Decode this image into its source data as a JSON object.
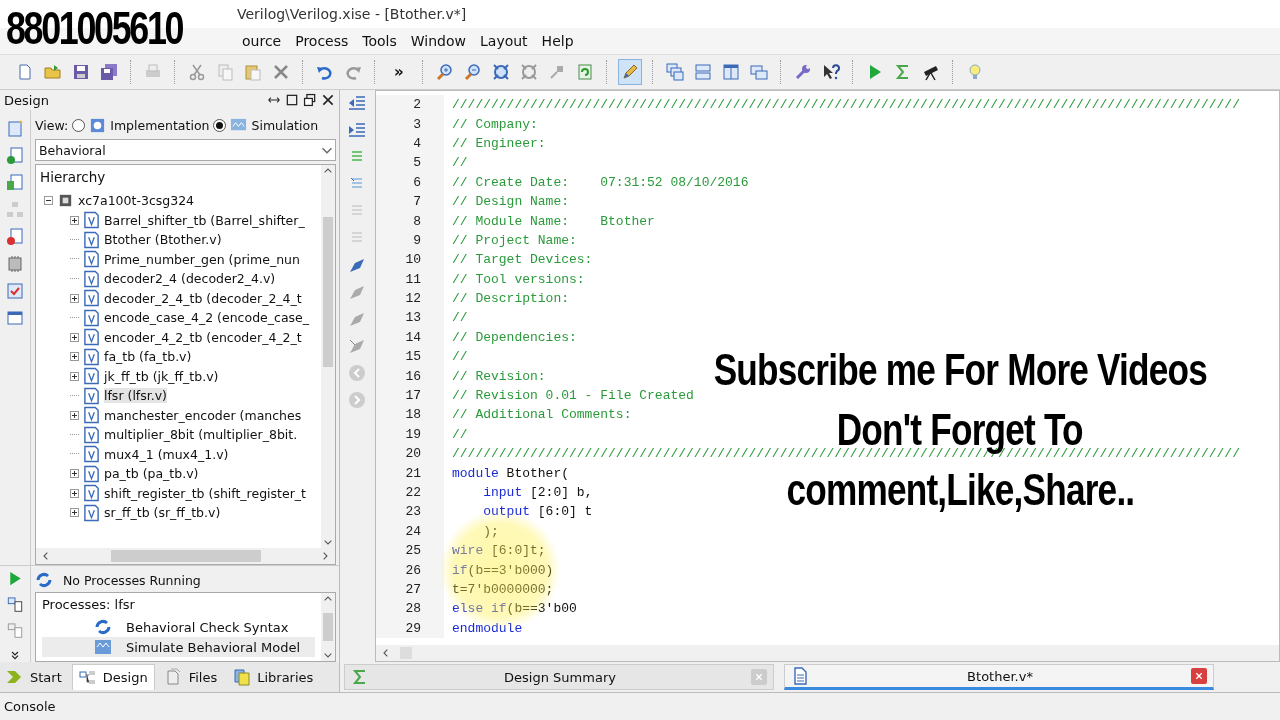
{
  "overlay_caption": {
    "phone": "8801005610",
    "lines": [
      "Subscribe me For More Videos",
      "Don't Forget To",
      "comment,Like,Share.."
    ]
  },
  "window": {
    "title": "Verilog\\Verilog.xise - [Btother.v*]"
  },
  "menu": [
    "ource",
    "Process",
    "Tools",
    "Window",
    "Layout",
    "Help"
  ],
  "toolbar": {
    "overflow": "»"
  },
  "design_panel": {
    "title": "Design",
    "view_label": "View:",
    "views": [
      {
        "label": "Implementation",
        "selected": false
      },
      {
        "label": "Simulation",
        "selected": true
      }
    ],
    "dropdown": {
      "value": "Behavioral"
    },
    "hierarchy": {
      "title": "Hierarchy",
      "tree": [
        {
          "label": "xc7a100t-3csg324",
          "expanded": true,
          "children": [
            {
              "label": "Barrel_shifter_tb (Barrel_shifter_",
              "kind": "group",
              "selected": false
            },
            {
              "label": "Btother (Btother.v)",
              "kind": "file",
              "selected": false
            },
            {
              "label": "Prime_number_gen (prime_nun",
              "kind": "file",
              "selected": false
            },
            {
              "label": "decoder2_4 (decoder2_4.v)",
              "kind": "file",
              "selected": false
            },
            {
              "label": "decoder_2_4_tb (decoder_2_4_t",
              "kind": "group",
              "selected": false
            },
            {
              "label": "encode_case_4_2 (encode_case_",
              "kind": "file",
              "selected": false
            },
            {
              "label": "encoder_4_2_tb (encoder_4_2_t",
              "kind": "group",
              "selected": false
            },
            {
              "label": "fa_tb (fa_tb.v)",
              "kind": "group",
              "selected": false
            },
            {
              "label": "jk_ff_tb (jk_ff_tb.v)",
              "kind": "group",
              "selected": false
            },
            {
              "label": "lfsr (lfsr.v)",
              "kind": "file",
              "selected": true
            },
            {
              "label": "manchester_encoder (manches",
              "kind": "group",
              "selected": false
            },
            {
              "label": "multiplier_8bit (multiplier_8bit.",
              "kind": "file",
              "selected": false
            },
            {
              "label": "mux4_1 (mux4_1.v)",
              "kind": "file",
              "selected": false
            },
            {
              "label": "pa_tb (pa_tb.v)",
              "kind": "group",
              "selected": false
            },
            {
              "label": "shift_register_tb (shift_register_t",
              "kind": "group",
              "selected": false
            },
            {
              "label": "sr_ff_tb (sr_ff_tb.v)",
              "kind": "group",
              "selected": false
            }
          ]
        }
      ]
    },
    "process_status": "No Processes Running",
    "processes": {
      "title": "Processes: lfsr",
      "items": [
        {
          "label": "Behavioral Check Syntax",
          "kind": "check",
          "selected": false
        },
        {
          "label": "Simulate Behavioral Model",
          "kind": "simulate",
          "selected": true
        }
      ]
    }
  },
  "panel_tabs": [
    {
      "label": "Start",
      "kind": "start",
      "selected": false
    },
    {
      "label": "Design",
      "kind": "design",
      "selected": true
    },
    {
      "label": "Files",
      "kind": "files",
      "selected": false
    },
    {
      "label": "Libraries",
      "kind": "libraries",
      "selected": false
    }
  ],
  "editor": {
    "lines": [
      {
        "number": "2",
        "indented": false,
        "segments": [
          {
            "kind": "comment",
            "text": "/////////////////////////////////////////////////////////////////////////////////////////////////////"
          }
        ]
      },
      {
        "number": "3",
        "indented": false,
        "segments": [
          {
            "kind": "comment",
            "text": "// Company:"
          }
        ]
      },
      {
        "number": "4",
        "indented": false,
        "segments": [
          {
            "kind": "comment",
            "text": "// Engineer:"
          }
        ]
      },
      {
        "number": "5",
        "indented": false,
        "segments": [
          {
            "kind": "comment",
            "text": "//"
          }
        ]
      },
      {
        "number": "6",
        "indented": false,
        "segments": [
          {
            "kind": "comment",
            "text": "// Create Date:    07:31:52 08/10/2016"
          }
        ]
      },
      {
        "number": "7",
        "indented": false,
        "segments": [
          {
            "kind": "comment",
            "text": "// Design Name:"
          }
        ]
      },
      {
        "number": "8",
        "indented": false,
        "segments": [
          {
            "kind": "comment",
            "text": "// Module Name:    Btother"
          }
        ]
      },
      {
        "number": "9",
        "indented": false,
        "segments": [
          {
            "kind": "comment",
            "text": "// Project Name:"
          }
        ]
      },
      {
        "number": "10",
        "indented": false,
        "segments": [
          {
            "kind": "comment",
            "text": "// Target Devices:"
          }
        ]
      },
      {
        "number": "11",
        "indented": false,
        "segments": [
          {
            "kind": "comment",
            "text": "// Tool versions:"
          }
        ]
      },
      {
        "number": "12",
        "indented": false,
        "segments": [
          {
            "kind": "comment",
            "text": "// Description:"
          }
        ]
      },
      {
        "number": "13",
        "indented": false,
        "segments": [
          {
            "kind": "comment",
            "text": "//"
          }
        ]
      },
      {
        "number": "14",
        "indented": false,
        "segments": [
          {
            "kind": "comment",
            "text": "// Dependencies:"
          }
        ]
      },
      {
        "number": "15",
        "indented": false,
        "segments": [
          {
            "kind": "comment",
            "text": "//"
          }
        ]
      },
      {
        "number": "16",
        "indented": false,
        "segments": [
          {
            "kind": "comment",
            "text": "// Revision:"
          }
        ]
      },
      {
        "number": "17",
        "indented": false,
        "segments": [
          {
            "kind": "comment",
            "text": "// Revision 0.01 - File Created"
          }
        ]
      },
      {
        "number": "18",
        "indented": false,
        "segments": [
          {
            "kind": "comment",
            "text": "// Additional Comments:"
          }
        ]
      },
      {
        "number": "19",
        "indented": false,
        "segments": [
          {
            "kind": "comment",
            "text": "//"
          }
        ]
      },
      {
        "number": "20",
        "indented": false,
        "segments": [
          {
            "kind": "comment",
            "text": "/////////////////////////////////////////////////////////////////////////////////////////////////////"
          }
        ]
      },
      {
        "number": "21",
        "indented": false,
        "segments": [
          {
            "kind": "keyword",
            "text": "module"
          },
          {
            "kind": "plain",
            "text": " Btother("
          }
        ]
      },
      {
        "number": "22",
        "indented": true,
        "segments": [
          {
            "kind": "keyword",
            "text": "input"
          },
          {
            "kind": "plain",
            "text": " [2:0] b,"
          }
        ]
      },
      {
        "number": "23",
        "indented": true,
        "segments": [
          {
            "kind": "keyword",
            "text": "output"
          },
          {
            "kind": "plain",
            "text": " [6:0] t"
          }
        ]
      },
      {
        "number": "24",
        "indented": true,
        "segments": [
          {
            "kind": "plain",
            "text": ");"
          }
        ]
      },
      {
        "number": "25",
        "indented": false,
        "segments": [
          {
            "kind": "keyword",
            "text": "wire"
          },
          {
            "kind": "plain",
            "text": " [6:0]t;"
          }
        ]
      },
      {
        "number": "26",
        "indented": false,
        "segments": [
          {
            "kind": "keyword",
            "text": "if"
          },
          {
            "kind": "plain",
            "text": "(b==3'b000)"
          }
        ]
      },
      {
        "number": "27",
        "indented": false,
        "segments": [
          {
            "kind": "plain",
            "text": "t=7'b0000000;"
          }
        ]
      },
      {
        "number": "28",
        "indented": false,
        "segments": [
          {
            "kind": "keyword",
            "text": "else if"
          },
          {
            "kind": "plain",
            "text": "(b==3'b00"
          }
        ]
      },
      {
        "number": "29",
        "indented": false,
        "segments": [
          {
            "kind": "keyword",
            "text": "endmodule"
          }
        ]
      }
    ]
  },
  "editor_tabs": [
    {
      "label": "Design Summary",
      "kind": "summary",
      "selected": false
    },
    {
      "label": "Btother.v*",
      "kind": "source",
      "selected": true
    }
  ],
  "console": {
    "title": "Console"
  }
}
